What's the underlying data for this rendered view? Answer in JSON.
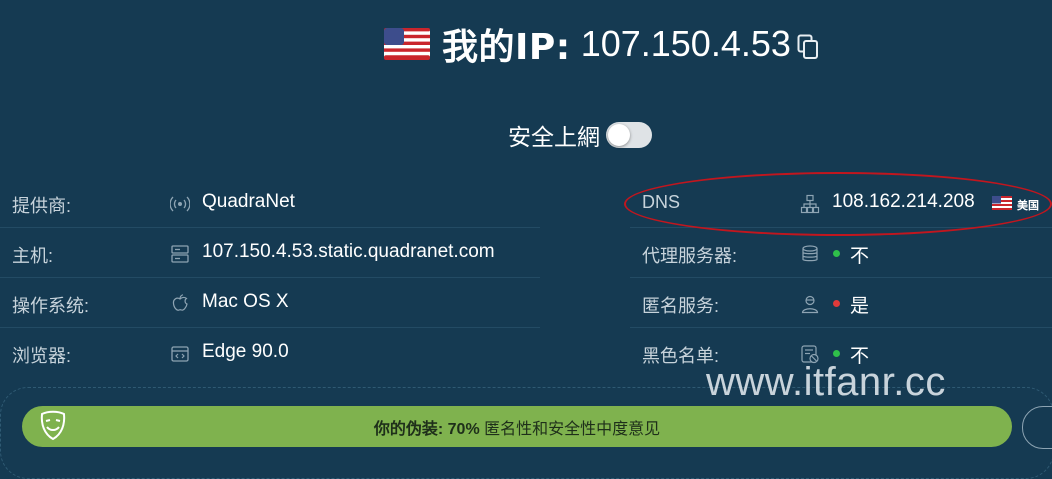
{
  "header": {
    "ip_label": "我的IP:",
    "ip_value": "107.150.4.53"
  },
  "secure": {
    "label": "安全上網",
    "enabled": false
  },
  "left_rows": [
    {
      "label": "提供商:",
      "value": "QuadraNet",
      "icon": "broadcast-icon"
    },
    {
      "label": "主机:",
      "value": "107.150.4.53.static.quadranet.com",
      "icon": "server-icon"
    },
    {
      "label": "操作系统:",
      "value": "Mac OS X",
      "icon": "apple-icon"
    },
    {
      "label": "浏览器:",
      "value": "Edge 90.0",
      "icon": "browser-code-icon"
    }
  ],
  "right_rows": [
    {
      "label": "DNS",
      "value": "108.162.214.208",
      "icon": "network-icon",
      "country": "美国"
    },
    {
      "label": "代理服务器:",
      "value": "不",
      "icon": "database-icon",
      "status_color": "#2fbf4a"
    },
    {
      "label": "匿名服务:",
      "value": "是",
      "icon": "user-icon",
      "status_color": "#e03a3a"
    },
    {
      "label": "黑色名单:",
      "value": "不",
      "icon": "blacklist-icon",
      "status_color": "#2fbf4a"
    }
  ],
  "disguise": {
    "prefix": "你的伪装:",
    "percent": "70%",
    "suffix": "匿名性和安全性中度意见",
    "level": 0.7
  },
  "watermark": "www.itfanr.cc",
  "colors": {
    "background": "#153a52",
    "bar": "#7fb24e",
    "green_dot": "#2fbf4a",
    "red_dot": "#e03a3a",
    "annotation": "#c2161e"
  }
}
